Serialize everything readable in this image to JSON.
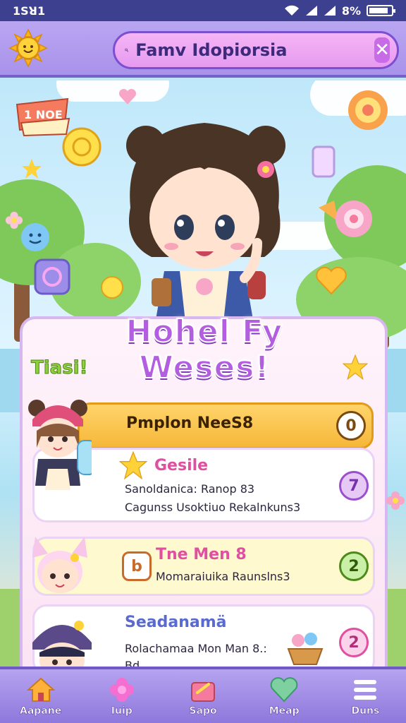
{
  "status_bar": {
    "time": "1ꓢꓤ1",
    "battery": "8%"
  },
  "search": {
    "value": "Famv Idopiorsia"
  },
  "title": "Hohel Fy Weses!",
  "corner_badge": "1 NOE",
  "section_label": "Tiasi!",
  "highlight": {
    "label": "Pmplon Neeꓢ8",
    "badge": "0"
  },
  "cards": [
    {
      "heading": "Gesile",
      "line1": "Sanoldanica: Ranop 83",
      "line2": "Cagunss Usoktiuo Rekalnkuns3",
      "badge": "7"
    },
    {
      "heading": "Tne Men 8",
      "line1": "Momaraiuika Raunslns3",
      "badge": "2",
      "letter": "b"
    },
    {
      "heading": "Seadanamä",
      "line1": "Rolachamaa Mon Man 8.:",
      "line2": "Bd",
      "badge": "2"
    }
  ],
  "nav": [
    {
      "label": "Aapane",
      "icon": "home-icon"
    },
    {
      "label": "Iuip",
      "icon": "flower-icon"
    },
    {
      "label": "Sapo",
      "icon": "shop-icon"
    },
    {
      "label": "Meap",
      "icon": "heart-icon"
    },
    {
      "label": "Duns",
      "icon": "menu-icon"
    }
  ],
  "colors": {
    "accent": "#b35de0",
    "bar": "#a992ea",
    "highlight": "#f6b73a"
  }
}
